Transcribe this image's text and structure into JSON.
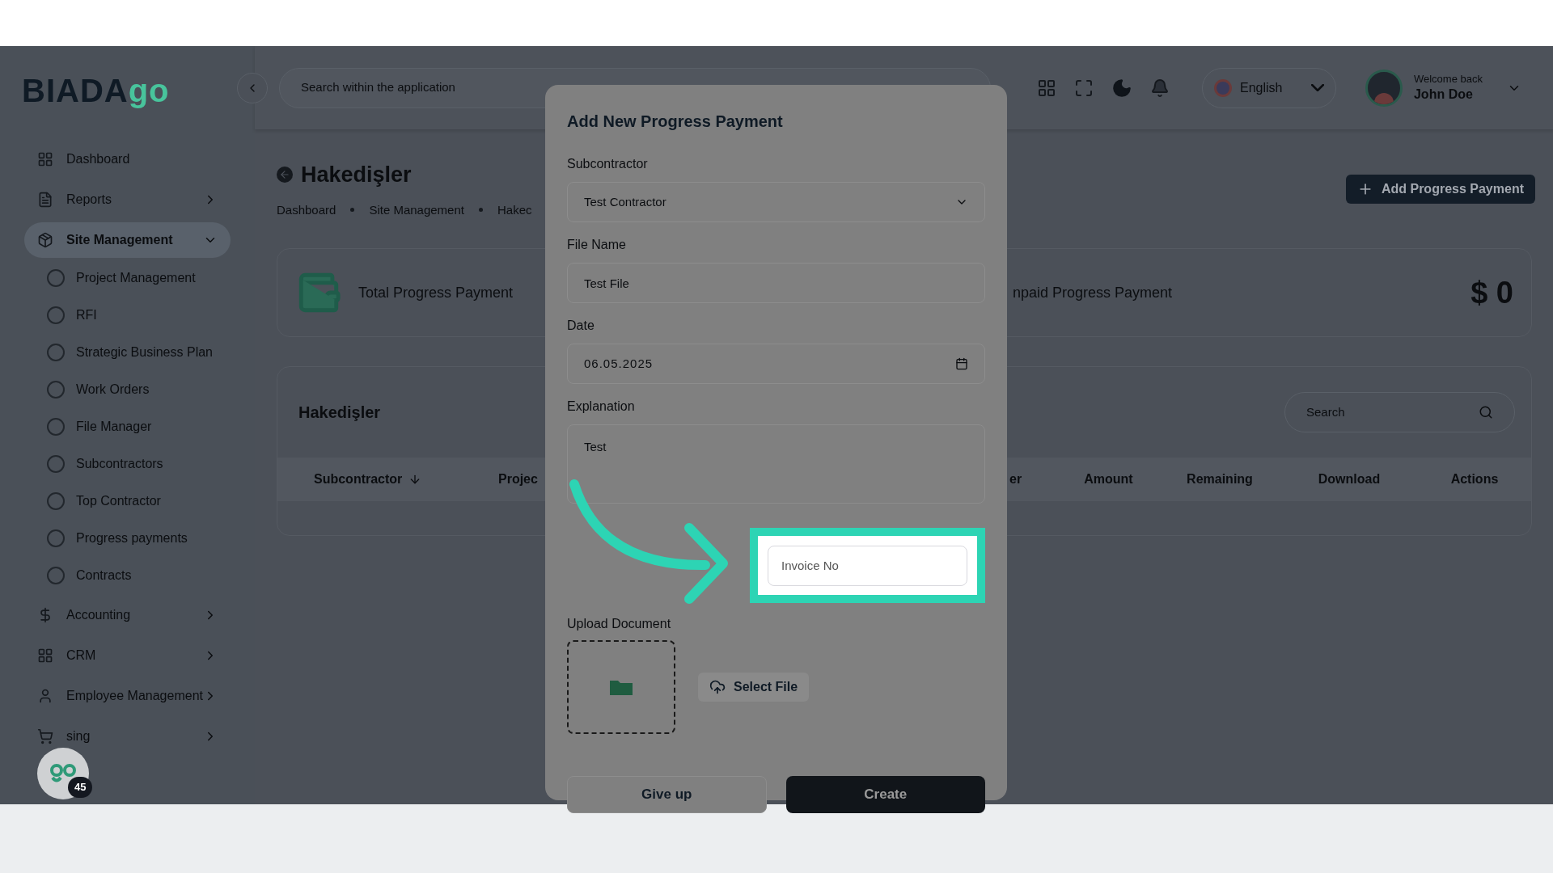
{
  "logo": {
    "text": "BIADA",
    "accent": "go"
  },
  "header": {
    "search_placeholder": "Search within the application",
    "language": "English",
    "user": {
      "greeting": "Welcome back",
      "name": "John Doe"
    }
  },
  "sidebar": {
    "items": [
      {
        "kind": "link",
        "label": "Dashboard",
        "selected": false
      },
      {
        "kind": "group",
        "label": "Reports",
        "selected": false,
        "expanded": false
      },
      {
        "kind": "group",
        "label": "Site Management",
        "selected": true,
        "expanded": true,
        "children": [
          {
            "label": "Project Management"
          },
          {
            "label": "RFI"
          },
          {
            "label": "Strategic Business Plan"
          },
          {
            "label": "Work Orders"
          },
          {
            "label": "File Manager"
          },
          {
            "label": "Subcontractors"
          },
          {
            "label": "Top Contractor"
          },
          {
            "label": "Progress payments"
          },
          {
            "label": "Contracts"
          }
        ]
      },
      {
        "kind": "group",
        "label": "Accounting",
        "selected": false,
        "expanded": false
      },
      {
        "kind": "group",
        "label": "CRM",
        "selected": false,
        "expanded": false
      },
      {
        "kind": "group",
        "label": "Employee Management",
        "selected": false,
        "expanded": false
      },
      {
        "kind": "group",
        "label": "sing",
        "selected": false,
        "expanded": false
      }
    ]
  },
  "chat_bubble": {
    "badge": "45"
  },
  "page": {
    "title": "Hakedişler",
    "breadcrumbs": [
      "Dashboard",
      "Site Management",
      "Hakec"
    ],
    "add_button": "Add Progress Payment"
  },
  "stats": [
    {
      "label": "Total Progress Payment"
    },
    {
      "label": "npaid Progress Payment",
      "value": "$ 0"
    }
  ],
  "table": {
    "title": "Hakedişler",
    "search_placeholder": "Search",
    "columns": [
      {
        "label": "Subcontractor",
        "sorted": true
      },
      {
        "label": "Projec",
        "sorted": false
      },
      {
        "label": "er",
        "sorted": false
      },
      {
        "label": "Amount",
        "sorted": false
      },
      {
        "label": "Remaining",
        "sorted": false
      },
      {
        "label": "Download",
        "sorted": false
      },
      {
        "label": "Actions",
        "sorted": false
      }
    ]
  },
  "modal": {
    "title": "Add New Progress Payment",
    "fields": [
      {
        "kind": "select",
        "label": "Subcontractor",
        "value": "Test Contractor"
      },
      {
        "kind": "text",
        "label": "File Name",
        "value": "Test File"
      },
      {
        "kind": "date",
        "label": "Date",
        "value": "06.05.2025"
      },
      {
        "kind": "textarea",
        "label": "Explanation",
        "value": "Test"
      },
      {
        "kind": "highlighted",
        "placeholder": "Invoice No"
      }
    ],
    "upload": {
      "label": "Upload Document",
      "button": "Select File"
    },
    "buttons": [
      {
        "label": "Give up",
        "kind": "secondary"
      },
      {
        "label": "Create",
        "kind": "primary"
      }
    ]
  }
}
